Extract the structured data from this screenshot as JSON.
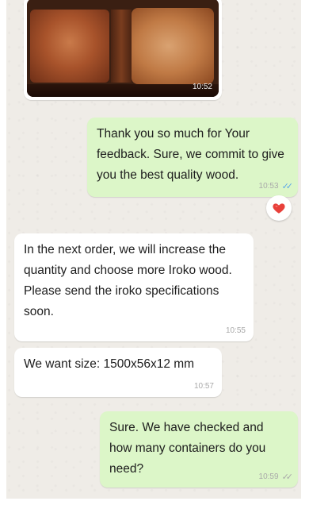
{
  "messages": [
    {
      "id": "m0",
      "direction": "incoming",
      "type": "image",
      "time": "10:52"
    },
    {
      "id": "m1",
      "direction": "outgoing",
      "text": "Thank you so much for Your feedback. Sure, we commit to give you the best quality wood.",
      "time": "10:53",
      "status": "read",
      "reaction": "red-heart-icon"
    },
    {
      "id": "m2",
      "direction": "incoming",
      "text": "In the next order, we will increase the quantity and choose more Iroko wood. Please send the iroko specifications soon.",
      "time": "10:55"
    },
    {
      "id": "m3",
      "direction": "incoming",
      "text": "We want size: 1500x56x12 mm",
      "time": "10:57"
    },
    {
      "id": "m4",
      "direction": "outgoing",
      "text": "Sure. We have checked and how many containers do you need?",
      "time": "10:59",
      "status": "delivered"
    }
  ],
  "colors": {
    "background": "#efece7",
    "incoming_bubble": "#ffffff",
    "outgoing_bubble": "#dcf6c8",
    "read_ticks": "#5aa7e8",
    "heart": "#e8403a"
  }
}
